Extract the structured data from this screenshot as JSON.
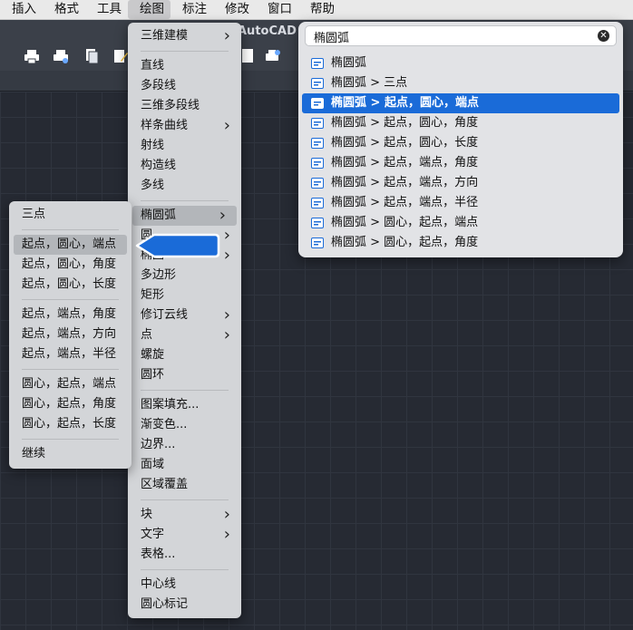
{
  "menubar": [
    "插入",
    "格式",
    "工具",
    "绘图",
    "标注",
    "修改",
    "窗口",
    "帮助"
  ],
  "app_title": "AutoCAD",
  "draw_menu": {
    "group1": [
      {
        "label": "三维建模",
        "submenu": true
      }
    ],
    "group2": [
      {
        "label": "直线",
        "submenu": false
      },
      {
        "label": "多段线",
        "submenu": false
      },
      {
        "label": "三维多段线",
        "submenu": false
      },
      {
        "label": "样条曲线",
        "submenu": true
      },
      {
        "label": "射线",
        "submenu": false
      },
      {
        "label": "构造线",
        "submenu": false
      },
      {
        "label": "多线",
        "submenu": false
      }
    ],
    "group3": [
      {
        "label": "椭圆弧",
        "submenu": true,
        "highlighted": true
      },
      {
        "label": "圆",
        "submenu": true
      },
      {
        "label": "椭圆",
        "submenu": true
      },
      {
        "label": "多边形",
        "submenu": false
      },
      {
        "label": "矩形",
        "submenu": false
      },
      {
        "label": "修订云线",
        "submenu": true
      },
      {
        "label": "点",
        "submenu": true
      },
      {
        "label": "螺旋",
        "submenu": false
      },
      {
        "label": "圆环",
        "submenu": false
      }
    ],
    "group4": [
      {
        "label": "图案填充...",
        "submenu": false
      },
      {
        "label": "渐变色...",
        "submenu": false
      },
      {
        "label": "边界...",
        "submenu": false
      },
      {
        "label": "面域",
        "submenu": false
      },
      {
        "label": "区域覆盖",
        "submenu": false
      }
    ],
    "group5": [
      {
        "label": "块",
        "submenu": true
      },
      {
        "label": "文字",
        "submenu": true
      },
      {
        "label": "表格...",
        "submenu": false
      }
    ],
    "group6": [
      {
        "label": "中心线",
        "submenu": false
      },
      {
        "label": "圆心标记",
        "submenu": false
      }
    ]
  },
  "arc_submenu": {
    "groups": [
      [
        "三点"
      ],
      [
        "起点，圆心，端点",
        "起点，圆心，角度",
        "起点，圆心，长度"
      ],
      [
        "起点，端点，角度",
        "起点，端点，方向",
        "起点，端点，半径"
      ],
      [
        "圆心，起点，端点",
        "圆心，起点，角度",
        "圆心，起点，长度"
      ],
      [
        "继续"
      ]
    ],
    "highlighted": "起点，圆心，端点"
  },
  "search": {
    "value": "椭圆弧",
    "results": [
      "椭圆弧",
      "椭圆弧 > 三点",
      "椭圆弧 > 起点，圆心，端点",
      "椭圆弧 > 起点，圆心，角度",
      "椭圆弧 > 起点，圆心，长度",
      "椭圆弧 > 起点，端点，角度",
      "椭圆弧 > 起点，端点，方向",
      "椭圆弧 > 起点，端点，半径",
      "椭圆弧 > 圆心，起点，端点",
      "椭圆弧 > 圆心，起点，角度"
    ],
    "selected_index": 2
  },
  "colors": {
    "accent": "#1a6bd8",
    "menu_bg": "#d3d5d8",
    "canvas": "#262a33"
  }
}
